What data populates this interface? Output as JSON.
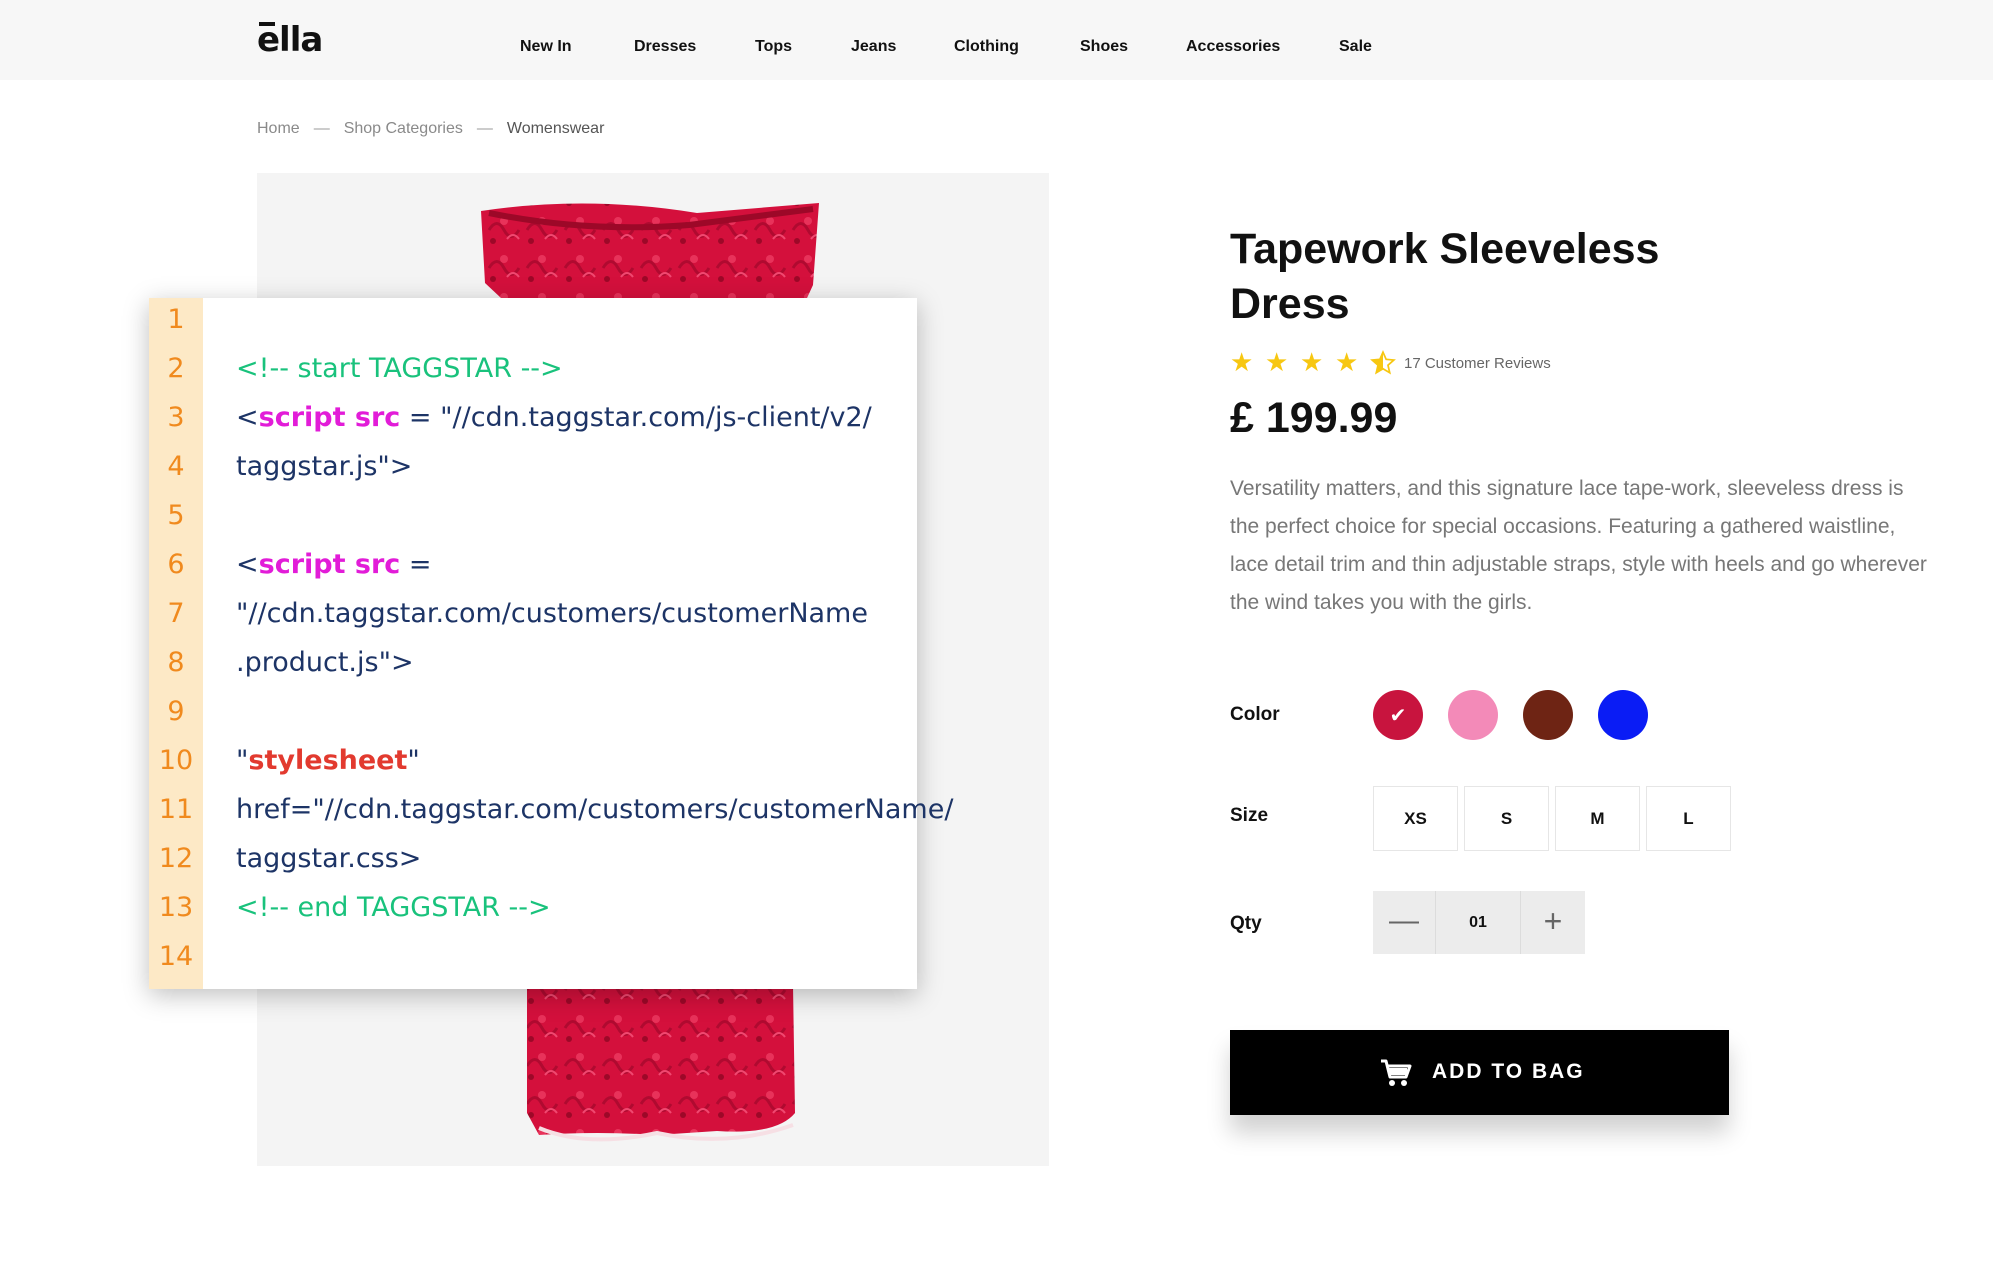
{
  "header": {
    "logo": "ella",
    "nav": [
      "New In",
      "Dresses",
      "Tops",
      "Jeans",
      "Clothing",
      "Shoes",
      "Accessories",
      "Sale"
    ]
  },
  "breadcrumb": {
    "items": [
      "Home",
      "Shop Categories",
      "Womenswear"
    ],
    "separator": "—"
  },
  "code": {
    "line_numbers": [
      "1",
      "2",
      "3",
      "4",
      "5",
      "6",
      "7",
      "8",
      "9",
      "10",
      "11",
      "12",
      "13",
      "14"
    ],
    "l2": "<!-- start TAGGSTAR -->",
    "l3_open": "<",
    "l3_kw": "script src",
    "l3_rest": " = \"//cdn.taggstar.com/js-client/v2/",
    "l4": "taggstar.js\">",
    "l6_open": "<",
    "l6_kw": "script src",
    "l6_rest": " =",
    "l7": "\"//cdn.taggstar.com/customers/customerName",
    "l8": ".product.js\">",
    "l10_q1": "\"",
    "l10_kw": "stylesheet",
    "l10_q2": "\"",
    "l11": "href=\"//cdn.taggstar.com/customers/customerName/",
    "l12": "taggstar.css>",
    "l13": "<!-- end TAGGSTAR -->"
  },
  "product": {
    "title": "Tapework Sleeveless Dress",
    "rating": 4.5,
    "reviews": "17 Customer Reviews",
    "price": "£ 199.99",
    "description": "Versatility matters, and this signature lace tape-work, sleeveless dress is the perfect choice for special occasions. Featuring a gathered waistline, lace detail trim and thin adjustable straps, style with heels and go wherever the wind takes you with the girls."
  },
  "options": {
    "color_label": "Color",
    "colors": [
      "#c8143e",
      "#f38ab8",
      "#6e2414",
      "#0a1cf5"
    ],
    "selected_color": 0,
    "size_label": "Size",
    "sizes": [
      "XS",
      "S",
      "M",
      "L"
    ],
    "qty_label": "Qty",
    "qty": "01",
    "qty_minus": "—",
    "qty_plus": "+"
  },
  "cta": {
    "label": "ADD TO BAG"
  },
  "colors": {
    "header_bg": "#f7f7f7",
    "button_bg": "#000000",
    "star": "#f7c711",
    "code_comment": "#19c27c",
    "code_keyword": "#e21cd8",
    "code_string": "#1d3466",
    "line_number": "#f08a1e",
    "gutter": "#fde9c6"
  }
}
